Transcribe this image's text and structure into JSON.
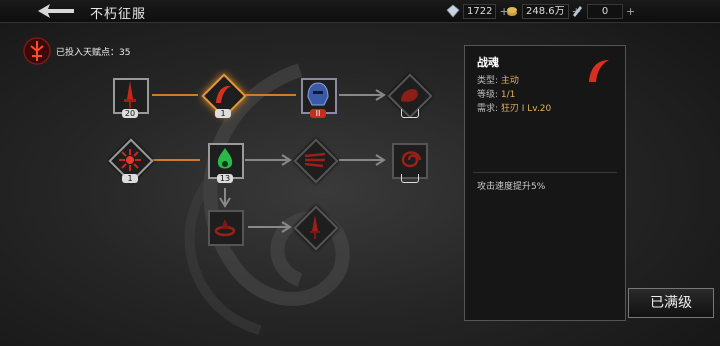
{
  "header": {
    "title": "不朽征服",
    "resources": [
      {
        "name": "diamond",
        "icon": "gem-icon",
        "value": "1722",
        "plus": "+"
      },
      {
        "name": "gold",
        "icon": "gold-coins-icon",
        "value": "248.6万",
        "plus": "+"
      },
      {
        "name": "crystal",
        "icon": "crystal-icon",
        "value": "0",
        "plus": "+"
      }
    ]
  },
  "talents": {
    "invested_label": "已投入天赋点：35",
    "nodes": [
      {
        "id": "sword",
        "badge": "20"
      },
      {
        "id": "war-soul",
        "badge": "1"
      },
      {
        "id": "shield",
        "badge": "II"
      },
      {
        "id": "arm",
        "badge": ""
      },
      {
        "id": "burst",
        "badge": "1"
      },
      {
        "id": "flame",
        "badge": "13"
      },
      {
        "id": "slash",
        "badge": ""
      },
      {
        "id": "vortex",
        "badge": ""
      },
      {
        "id": "ring",
        "badge": ""
      },
      {
        "id": "dagger",
        "badge": ""
      }
    ]
  },
  "detail": {
    "name": "战魂",
    "type_label": "类型:",
    "type_value": "主动",
    "level_label": "等级:",
    "level_value": "1/1",
    "req_label": "需求:",
    "req_value": "狂刃 I Lv.20",
    "description": "攻击速度提升5%"
  },
  "button": {
    "maxed": "已满级"
  },
  "colors": {
    "accent": "#e09a3a",
    "rune_red": "#c0281e",
    "gold_text": "#e0b060"
  }
}
